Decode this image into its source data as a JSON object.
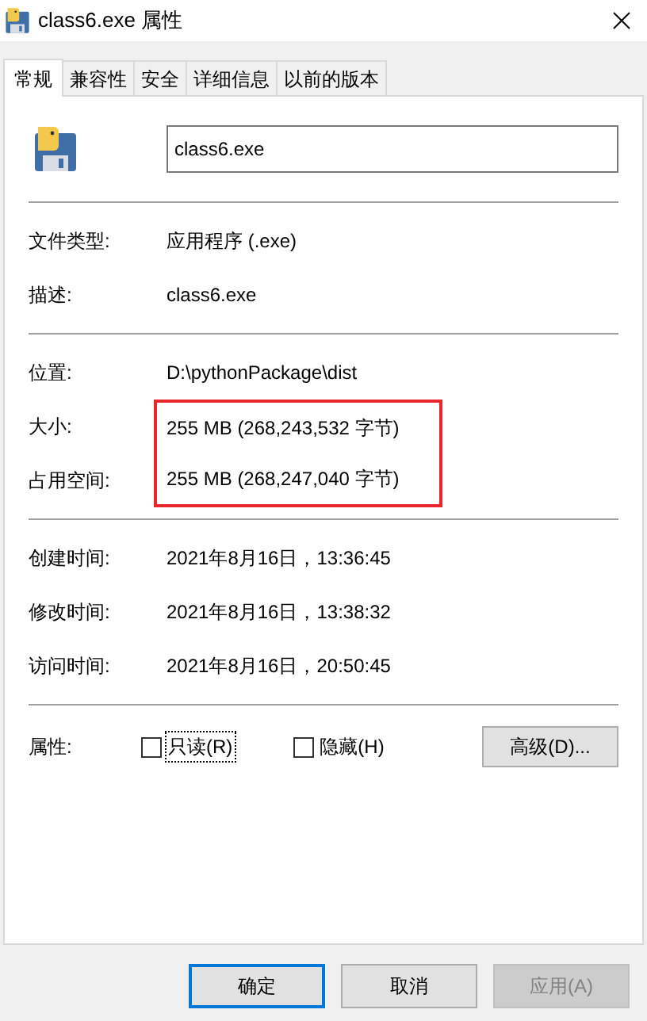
{
  "window": {
    "title": "class6.exe 属性"
  },
  "tabs": [
    {
      "label": "常规",
      "selected": true
    },
    {
      "label": "兼容性",
      "selected": false
    },
    {
      "label": "安全",
      "selected": false
    },
    {
      "label": "详细信息",
      "selected": false
    },
    {
      "label": "以前的版本",
      "selected": false
    }
  ],
  "file_name": "class6.exe",
  "sections": [
    [
      {
        "label": "文件类型:",
        "value": "应用程序 (.exe)",
        "highlighted": false
      },
      {
        "label": "描述:",
        "value": "class6.exe",
        "highlighted": false
      }
    ],
    [
      {
        "label": "位置:",
        "value": "D:\\pythonPackage\\dist",
        "highlighted": false
      },
      {
        "label": "大小:",
        "value": "255 MB (268,243,532 字节)",
        "highlighted": true
      },
      {
        "label": "占用空间:",
        "value": "255 MB (268,247,040 字节)",
        "highlighted": true
      }
    ],
    [
      {
        "label": "创建时间:",
        "value": "2021年8月16日，13:36:45",
        "highlighted": false
      },
      {
        "label": "修改时间:",
        "value": "2021年8月16日，13:38:32",
        "highlighted": false
      },
      {
        "label": "访问时间:",
        "value": "2021年8月16日，20:50:45",
        "highlighted": false
      }
    ]
  ],
  "attributes": {
    "label": "属性:",
    "checkboxes": [
      {
        "label": "只读(R)",
        "checked": false,
        "focused": true
      },
      {
        "label": "隐藏(H)",
        "checked": false,
        "focused": false
      }
    ],
    "advanced_button": "高级(D)..."
  },
  "buttons": [
    {
      "label": "确定",
      "default": true,
      "disabled": false
    },
    {
      "label": "取消",
      "default": false,
      "disabled": false
    },
    {
      "label": "应用(A)",
      "default": false,
      "disabled": true
    }
  ]
}
